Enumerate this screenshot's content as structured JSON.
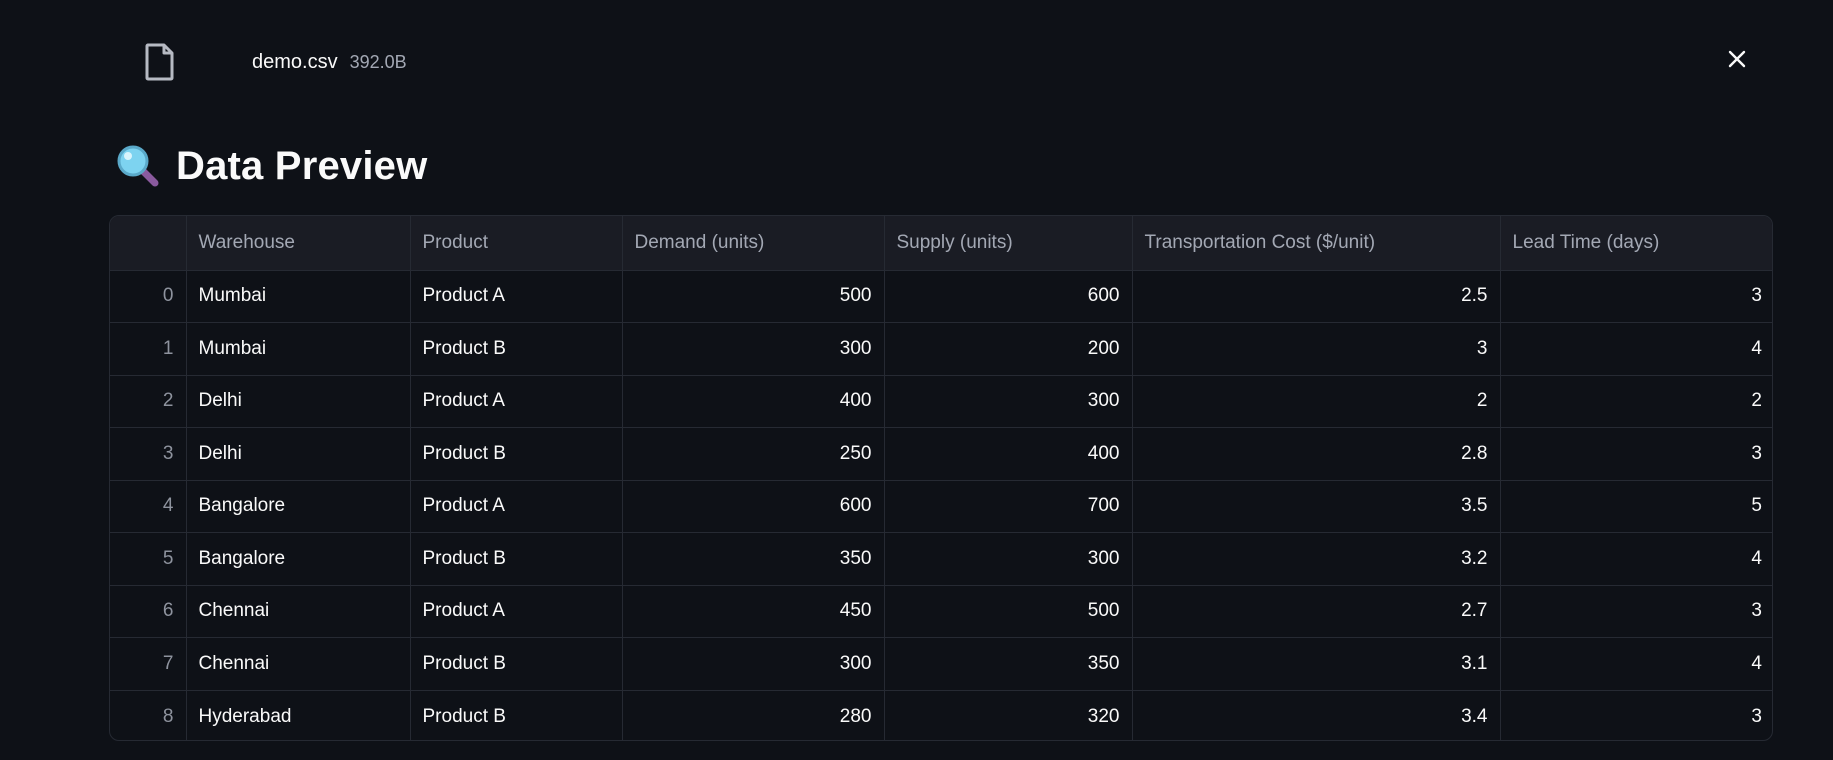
{
  "file": {
    "name": "demo.csv",
    "size": "392.0B",
    "icon": "file-icon"
  },
  "close": {
    "icon": "close-icon"
  },
  "section": {
    "icon": "magnifying-glass-icon",
    "title": "Data Preview"
  },
  "table": {
    "columns": [
      "",
      "Warehouse",
      "Product",
      "Demand (units)",
      "Supply (units)",
      "Transportation Cost ($/unit)",
      "Lead Time (days)"
    ],
    "rows": [
      [
        "0",
        "Mumbai",
        "Product A",
        "500",
        "600",
        "2.5",
        "3"
      ],
      [
        "1",
        "Mumbai",
        "Product B",
        "300",
        "200",
        "3",
        "4"
      ],
      [
        "2",
        "Delhi",
        "Product A",
        "400",
        "300",
        "2",
        "2"
      ],
      [
        "3",
        "Delhi",
        "Product B",
        "250",
        "400",
        "2.8",
        "3"
      ],
      [
        "4",
        "Bangalore",
        "Product A",
        "600",
        "700",
        "3.5",
        "5"
      ],
      [
        "5",
        "Bangalore",
        "Product B",
        "350",
        "300",
        "3.2",
        "4"
      ],
      [
        "6",
        "Chennai",
        "Product A",
        "450",
        "500",
        "2.7",
        "3"
      ],
      [
        "7",
        "Chennai",
        "Product B",
        "300",
        "350",
        "3.1",
        "4"
      ],
      [
        "8",
        "Hyderabad",
        "Product B",
        "280",
        "320",
        "3.4",
        "3"
      ]
    ]
  },
  "colors": {
    "background": "#0e1117",
    "header_bg": "#1a1c24",
    "grid": "#262a33",
    "text": "#fafafa",
    "muted": "#a3a8b4"
  }
}
